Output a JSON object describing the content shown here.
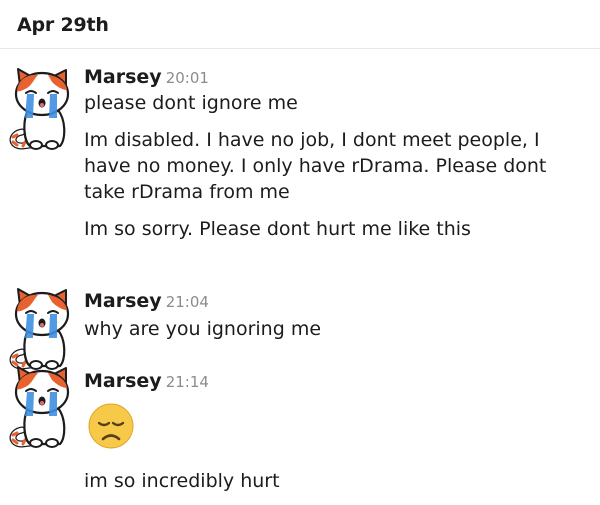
{
  "date_header": "Apr 29th",
  "messages": [
    {
      "author": "Marsey",
      "time": "20:01",
      "lines": [
        "please dont ignore me",
        "Im disabled. I have no job, I dont meet people, I have no money. I only have rDrama. Please dont take rDrama from me",
        "Im so sorry. Please dont hurt me like this"
      ]
    },
    {
      "author": "Marsey",
      "time": "21:04",
      "lines": [
        "why are you ignoring me"
      ]
    },
    {
      "author": "Marsey",
      "time": "21:14",
      "emoji": "disappointed-face-icon",
      "lines": [
        "im so incredibly hurt"
      ]
    }
  ],
  "colors": {
    "text": "#1d1c1d",
    "timestamp": "#8c8c8c",
    "divider": "#e8e8e8",
    "cat_orange": "#e8622f",
    "tears": "#3f8fe0",
    "emoji_yellow": "#f7c948"
  }
}
